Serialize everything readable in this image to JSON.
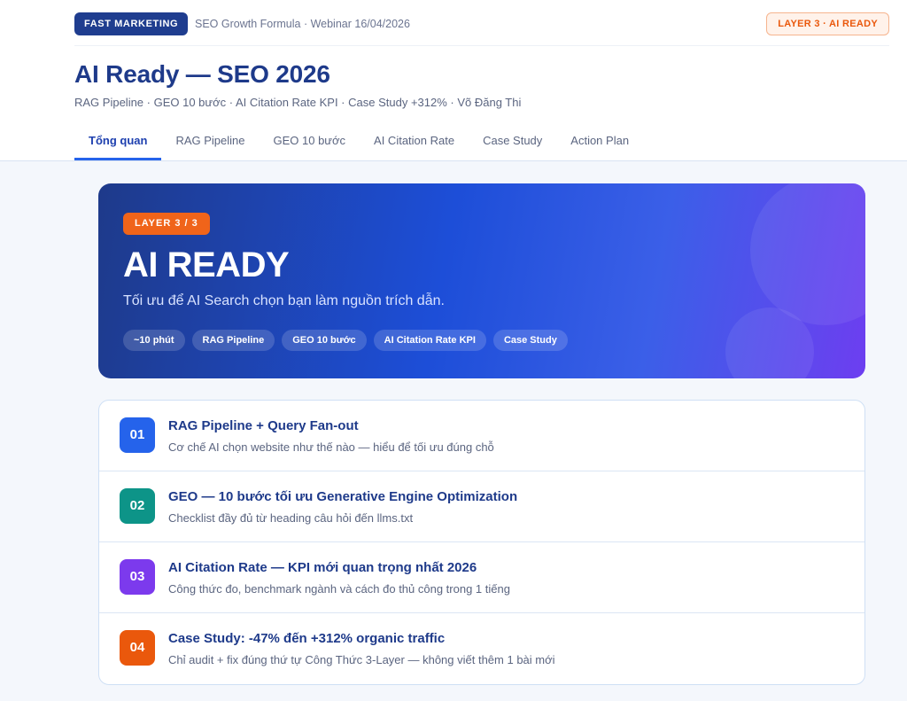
{
  "header": {
    "brand": "FAST MARKETING",
    "meta": "SEO Growth Formula · Webinar 16/04/2026",
    "layer_badge": "LAYER 3 · AI READY",
    "title": "AI Ready — SEO 2026",
    "subtitle": "RAG Pipeline · GEO 10 bước · AI Citation Rate KPI · Case Study +312% · Võ Đăng Thi"
  },
  "tabs": [
    {
      "label": "Tổng quan",
      "active": true
    },
    {
      "label": "RAG Pipeline",
      "active": false
    },
    {
      "label": "GEO 10 bước",
      "active": false
    },
    {
      "label": "AI Citation Rate",
      "active": false
    },
    {
      "label": "Case Study",
      "active": false
    },
    {
      "label": "Action Plan",
      "active": false
    }
  ],
  "hero": {
    "badge": "LAYER 3 / 3",
    "title": "AI READY",
    "subtitle": "Tối ưu để AI Search chọn bạn làm nguồn trích dẫn.",
    "chips": [
      "~10 phút",
      "RAG Pipeline",
      "GEO 10 bước",
      "AI Citation Rate KPI",
      "Case Study"
    ]
  },
  "sections": [
    {
      "num": "01",
      "color": "#2563eb",
      "title": "RAG Pipeline + Query Fan-out",
      "desc": "Cơ chế AI chọn website như thế nào — hiểu để tối ưu đúng chỗ"
    },
    {
      "num": "02",
      "color": "#0d9488",
      "title": "GEO — 10 bước tối ưu Generative Engine Optimization",
      "desc": "Checklist đầy đủ từ heading câu hỏi đến llms.txt"
    },
    {
      "num": "03",
      "color": "#7c3aed",
      "title": "AI Citation Rate — KPI mới quan trọng nhất 2026",
      "desc": "Công thức đo, benchmark ngành và cách đo thủ công trong 1 tiếng"
    },
    {
      "num": "04",
      "color": "#ea580c",
      "title": "Case Study: -47% đến +312% organic traffic",
      "desc": "Chỉ audit + fix đúng thứ tự Công Thức 3-Layer — không viết thêm 1 bài mới"
    }
  ]
}
